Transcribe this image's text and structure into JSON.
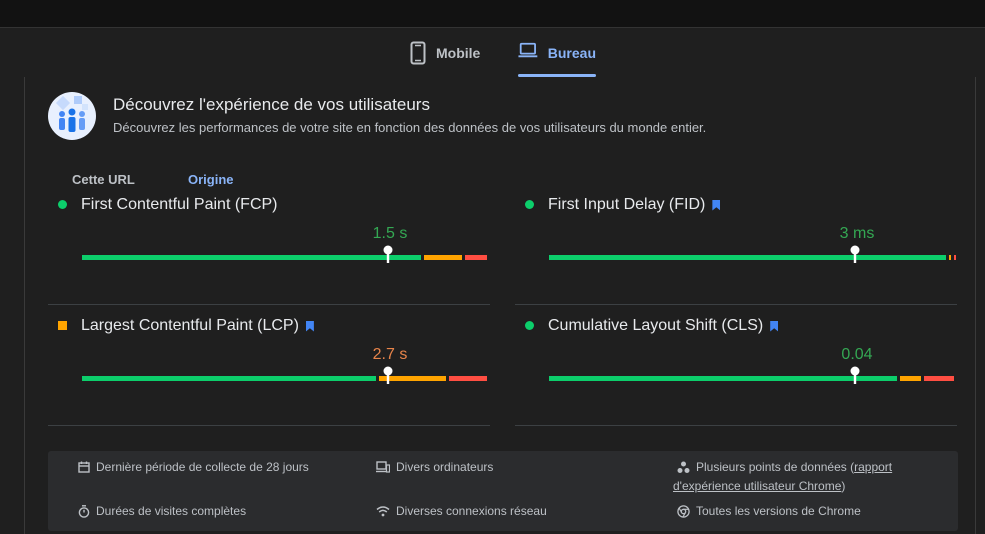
{
  "device_tabs": [
    {
      "label": "Mobile",
      "icon": "smartphone-icon",
      "active": false
    },
    {
      "label": "Bureau",
      "icon": "laptop-icon",
      "active": true
    }
  ],
  "hero": {
    "title": "Découvrez l'expérience de vos utilisateurs",
    "subtitle": "Découvrez les performances de votre site en fonction des données de vos utilisateurs du monde entier.",
    "icon": "users-illustration-icon"
  },
  "scope_tabs": [
    {
      "label": "Cette URL",
      "active": false
    },
    {
      "label": "Origine",
      "active": true
    }
  ],
  "colors": {
    "good": "#0cce6b",
    "average": "#ffa400",
    "poor": "#ff4e42",
    "accent": "#8ab4f8",
    "good_text": "#34a853",
    "average_text": "#e8844a"
  },
  "metrics": [
    {
      "name": "First Contentful Paint (FCP)",
      "value": "1.5 s",
      "status": "good",
      "core": false,
      "distribution": [
        0.83,
        0.1,
        0.06
      ],
      "marker": 0.75
    },
    {
      "name": "First Input Delay (FID)",
      "value": "3 ms",
      "status": "good",
      "core": true,
      "distribution": [
        0.97,
        0.01,
        0.01
      ],
      "marker": 0.75
    },
    {
      "name": "Largest Contentful Paint (LCP)",
      "value": "2.7 s",
      "status": "average",
      "core": true,
      "distribution": [
        0.72,
        0.17,
        0.1
      ],
      "marker": 0.75
    },
    {
      "name": "Cumulative Layout Shift (CLS)",
      "value": "0.04",
      "status": "good",
      "core": true,
      "distribution": [
        0.86,
        0.06,
        0.08
      ],
      "marker": 0.75
    }
  ],
  "footer": {
    "collection_period": "Dernière période de collecte de 28 jours",
    "devices": "Divers ordinateurs",
    "data_points_prefix": "Plusieurs points de données (",
    "data_points_link_1": "rapport",
    "data_points_link_2": "d'expérience utilisateur Chrome",
    "data_points_suffix": ")",
    "visit_durations": "Durées de visites complètes",
    "connections": "Diverses connexions réseau",
    "chrome_versions": "Toutes les versions de Chrome"
  }
}
